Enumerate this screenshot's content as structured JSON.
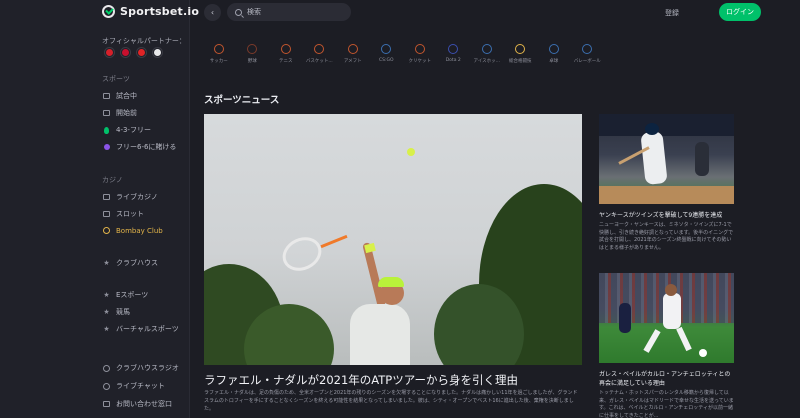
{
  "brand": {
    "name": "Sportsbet.io"
  },
  "header": {
    "search_placeholder": "検索",
    "register_label": "登録",
    "login_label": "ログイン"
  },
  "sidebar": {
    "partners_title": "オフィシャルパートナー：",
    "partners": [
      {
        "color": "#d6202a"
      },
      {
        "color": "#c8102e"
      },
      {
        "color": "#e02426"
      },
      {
        "color": "#ffffff"
      }
    ],
    "sports_section": "スポーツ",
    "sports_items": [
      "試合中",
      "開始前",
      "4-3-フリー",
      "フリー6-6に賭ける"
    ],
    "casino_section": "カジノ",
    "casino_items": [
      "ライブカジノ",
      "スロット",
      "Bombay Club"
    ],
    "clubhouse": "クラブハウス",
    "other_items": [
      "Eスポーツ",
      "競馬",
      "バーチャルスポーツ"
    ],
    "footer_items": [
      "クラブハウスラジオ",
      "ライブチャット",
      "お問い合わせ窓口"
    ]
  },
  "sports": [
    {
      "label": "サッカー",
      "color": "#c2562e"
    },
    {
      "label": "野球",
      "color": "#7a3a2a"
    },
    {
      "label": "テニス",
      "color": "#c2562e"
    },
    {
      "label": "バスケット...",
      "color": "#c2562e"
    },
    {
      "label": "アメフト",
      "color": "#c2562e"
    },
    {
      "label": "CS:GO",
      "color": "#3b6fb0"
    },
    {
      "label": "クリケット",
      "color": "#c2562e"
    },
    {
      "label": "Dota 2",
      "color": "#3b4fb0"
    },
    {
      "label": "アイスホッ...",
      "color": "#3b6fb0"
    },
    {
      "label": "総合格闘技",
      "color": "#e2b44a"
    },
    {
      "label": "卓球",
      "color": "#3b6fb0"
    },
    {
      "label": "バレーボール",
      "color": "#3b6fb0"
    }
  ],
  "news": {
    "section_title": "スポーツニュース",
    "main": {
      "headline": "ラファエル・ナダルが2021年のATPツアーから身を引く理由",
      "excerpt": "ラファエル・ナダルは、足の負傷のため、全米オープンと2021年の残りのシーズンを欠場することになりました。ナダルは痛かしい11年を過ごしましたが、グランドスラムのトロフィーを手にすることなくシーズンを終える可能性を結果となってしまいました。彼は、シティ・オープンでベスト16に進出した後、棄権を決断しました。"
    },
    "side": [
      {
        "headline": "ヤンキースがツインズを撃破して9連勝を達成",
        "excerpt": "ニューヨーク・ヤンキースは、ミネソタ・ツインズに7-1で快勝し、引き続き絶好調となっています。後半のイニングで試合を打開し、2021年のシーズン終盤戦に向けてその勢いはとまる様子がありません。"
      },
      {
        "headline": "ガレス・ベイルがカルロ・アンチェロッティとの再会に満足している理由",
        "excerpt": "トッテナム・ホットスパーのレンタル移籍から復帰して以来、ガレス・ベイルはマドリードで幸せな生活を送っています。これは、ベイルとカルロ・アンチェロッティが以前一緒に仕事をしてきたことが..."
      }
    ]
  }
}
